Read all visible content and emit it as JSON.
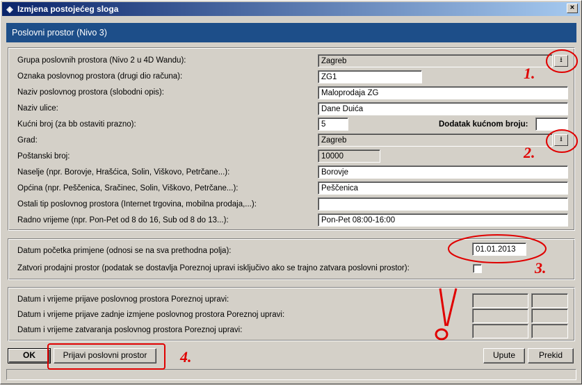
{
  "window": {
    "title": "Izmjena postojećeg sloga",
    "close": "×"
  },
  "header": {
    "title": "Poslovni prostor (Nivo 3)"
  },
  "section1": {
    "fields": [
      {
        "label": "Grupa poslovnih prostora (Nivo 2 u 4D Wandu):",
        "value": "Zagreb"
      },
      {
        "label": "Oznaka poslovnog prostora (drugi dio računa):",
        "value": "ZG1"
      },
      {
        "label": "Naziv poslovnog prostora (slobodni opis):",
        "value": "Maloprodaja ZG"
      },
      {
        "label": "Naziv ulice:",
        "value": "Dane Duića"
      },
      {
        "label": "Kućni broj (za bb ostaviti prazno):",
        "value": "5"
      },
      {
        "label": "Grad:",
        "value": "Zagreb"
      },
      {
        "label": "Poštanski broj:",
        "value": "10000"
      },
      {
        "label": "Naselje (npr. Borovje, Hrašćica, Solin, Viškovo, Petrčane...):",
        "value": "Borovje"
      },
      {
        "label": "Općina (npr. Peščenica, Sračinec, Solin, Viškovo, Petrčane...):",
        "value": "Peščenica"
      },
      {
        "label": "Ostali tip poslovnog prostora (Internet trgovina, mobilna prodaja,...):",
        "value": ""
      },
      {
        "label": "Radno vrijeme (npr. Pon-Pet od 8 do 16, Sub od 8 do 13...):",
        "value": "Pon-Pet 08:00-16:00"
      }
    ],
    "dodatak_label": "Dodatak kućnom broju:",
    "dodatak_value": "",
    "dropdown_glyph": "⭳"
  },
  "section2": {
    "date_label": "Datum početka primjene (odnosi se na sva prethodna polja):",
    "date_value": "01.01.2013",
    "close_label": "Zatvori prodajni prostor (podatak se dostavlja Poreznoj upravi isključivo ako se trajno zatvara poslovni prostor):"
  },
  "section3": {
    "labels": [
      "Datum i vrijeme prijave poslovnog prostora Poreznoj upravi:",
      "Datum i vrijeme prijave zadnje izmjene poslovnog prostora Poreznoj upravi:",
      "Datum i vrijeme zatvaranja poslovnog prostora Poreznoj upravi:"
    ]
  },
  "buttons": {
    "ok": "OK",
    "prijavi": "Prijavi poslovni prostor",
    "upute": "Upute",
    "prekid": "Prekid"
  },
  "annotations": {
    "n1": "1.",
    "n2": "2.",
    "n3": "3.",
    "n4": "4.",
    "exclaim": "!",
    "color": "#e00000"
  }
}
